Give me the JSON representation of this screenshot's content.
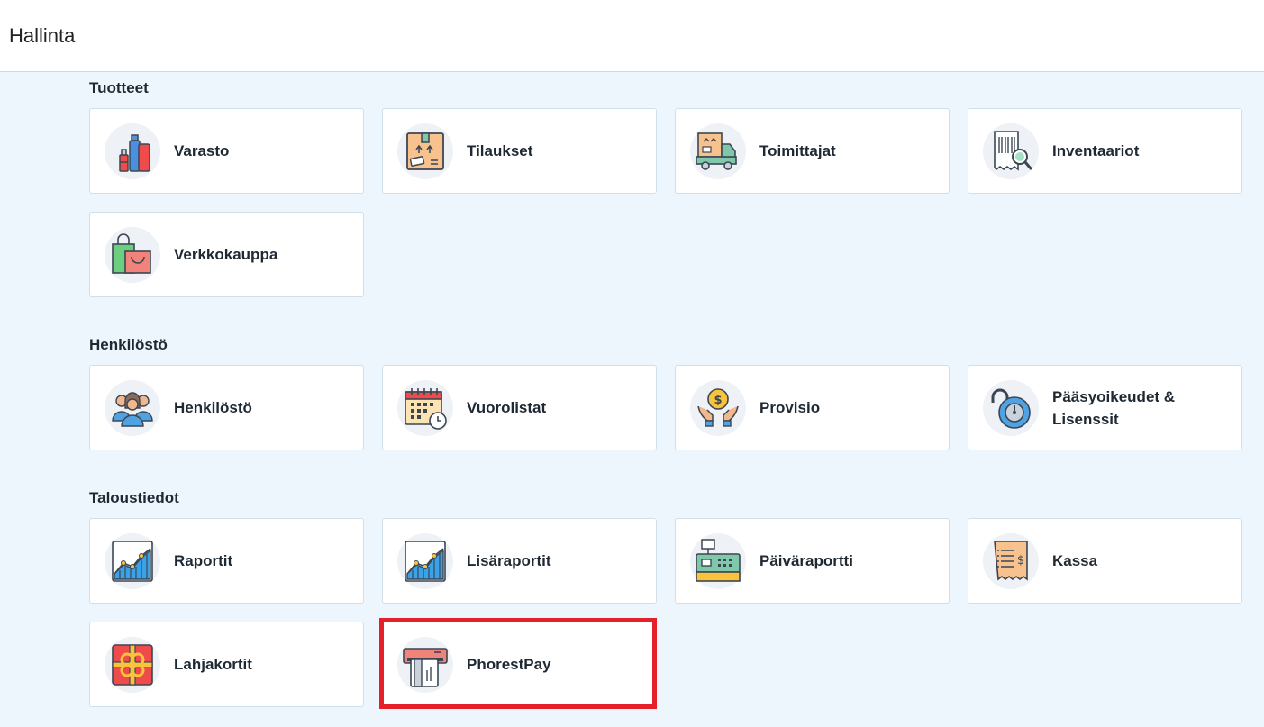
{
  "header": {
    "title": "Hallinta"
  },
  "sections": {
    "products": {
      "title": "Tuotteet",
      "items": [
        {
          "label": "Varasto",
          "icon": "cosmetics-icon"
        },
        {
          "label": "Tilaukset",
          "icon": "package-icon"
        },
        {
          "label": "Toimittajat",
          "icon": "delivery-truck-icon"
        },
        {
          "label": "Inventaariot",
          "icon": "barcode-search-icon"
        },
        {
          "label": "Verkkokauppa",
          "icon": "shopping-bags-icon"
        }
      ]
    },
    "staff": {
      "title": "Henkilöstö",
      "items": [
        {
          "label": "Henkilöstö",
          "icon": "people-group-icon"
        },
        {
          "label": "Vuorolistat",
          "icon": "calendar-clock-icon"
        },
        {
          "label": "Provisio",
          "icon": "coin-hands-icon"
        },
        {
          "label": "Pääsyoikeudet & Lisenssit",
          "icon": "padlock-dial-icon"
        }
      ]
    },
    "finance": {
      "title": "Taloustiedot",
      "items": [
        {
          "label": "Raportit",
          "icon": "growth-chart-icon"
        },
        {
          "label": "Lisäraportit",
          "icon": "growth-chart-icon"
        },
        {
          "label": "Päiväraportti",
          "icon": "cash-register-icon"
        },
        {
          "label": "Kassa",
          "icon": "receipt-icon"
        },
        {
          "label": "Lahjakortit",
          "icon": "gift-card-icon"
        },
        {
          "label": "PhorestPay",
          "icon": "card-terminal-icon"
        }
      ]
    }
  },
  "colors": {
    "highlight": "#e5202a",
    "background": "#eef6fd",
    "card_border": "#cfdfec"
  }
}
